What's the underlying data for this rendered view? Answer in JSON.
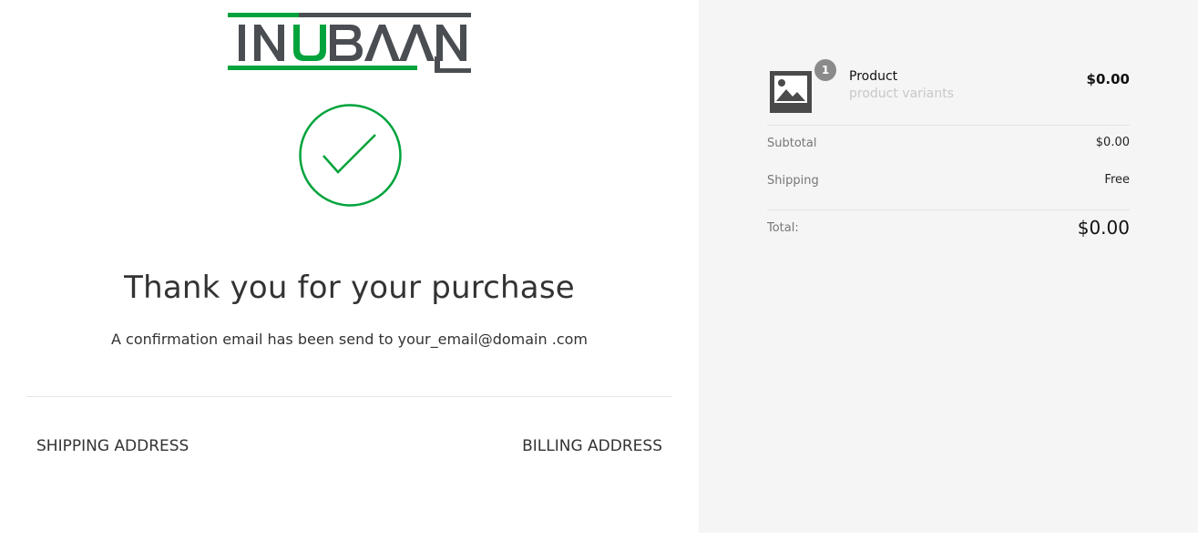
{
  "brand": {
    "logo_text": "INUBAAN",
    "colors": {
      "green": "#00a33c",
      "dark": "#4a4e52",
      "check": "#00a33c"
    }
  },
  "confirmation": {
    "title": "Thank you for your purchase",
    "message": "A confirmation email has been send to your_email@domain .com"
  },
  "addresses": {
    "shipping_label": "SHIPPING ADDRESS",
    "billing_label": "BILLING ADDRESS"
  },
  "order": {
    "item": {
      "quantity": "1",
      "name": "Product",
      "variants": "product variants",
      "price": "$0.00",
      "thumbnail_icon": "image-placeholder-icon"
    },
    "subtotal_label": "Subtotal",
    "subtotal_value": "$0.00",
    "shipping_label": "Shipping",
    "shipping_value": "Free",
    "total_label": "Total:",
    "total_value": "$0.00"
  }
}
